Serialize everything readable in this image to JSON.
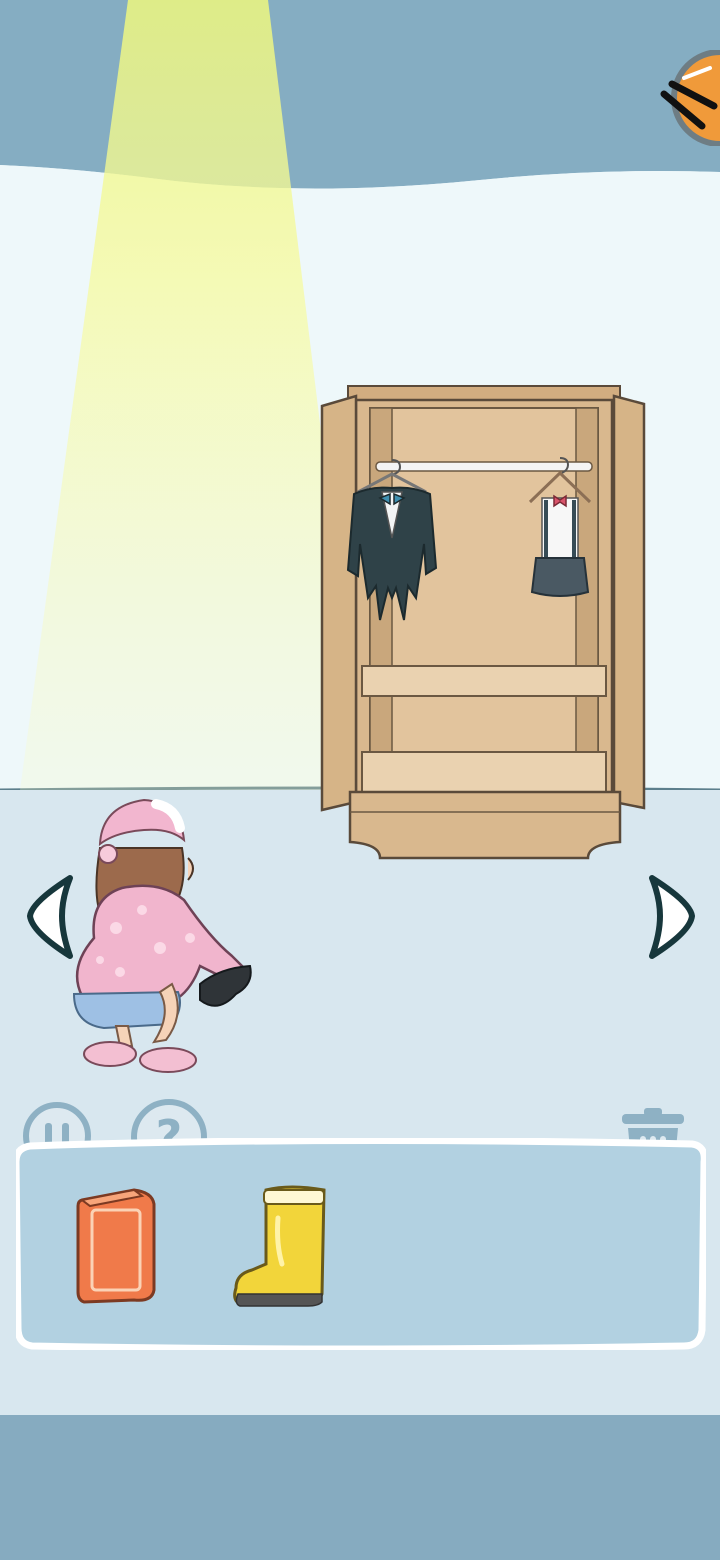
{
  "colors": {
    "ceiling": "#85adc2",
    "wall": "#eef8fa",
    "floor": "#d8e7ef",
    "spotlight": "#f4f79a",
    "wardrobe": "#d9b88e",
    "inventory_panel": "#b2d1e1",
    "ui_outline": "#8eb1c4",
    "bottom_bar": "#86abc0"
  },
  "scene": {
    "wardrobe": {
      "state": "open",
      "items": [
        "tuxedo",
        "suspender-outfit"
      ]
    },
    "character": {
      "pose": "crouching",
      "holding": "dark-cloth"
    },
    "spotlight": true
  },
  "controls": {
    "left_arrow_icon": "chevron-left",
    "right_arrow_icon": "chevron-right",
    "pause_icon": "pause",
    "hint_icon": "question-mark",
    "hint_label": "?",
    "trash_icon": "trash",
    "corner_badge_icon": "chopsticks-badge"
  },
  "inventory": {
    "items": [
      {
        "name": "book",
        "color": "#f07a4a"
      },
      {
        "name": "rain-boot",
        "color": "#f2d53a"
      }
    ]
  }
}
